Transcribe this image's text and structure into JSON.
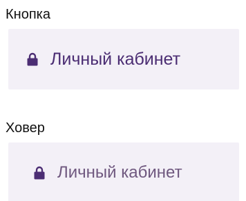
{
  "sections": {
    "normal": {
      "label": "Кнопка"
    },
    "hover": {
      "label": "Ховер"
    }
  },
  "button": {
    "label": "Личный кабинет",
    "icon": "lock-icon"
  },
  "colors": {
    "button_bg": "#f3f0f7",
    "normal_icon": "#4b2d73",
    "normal_text": "#4b2d73",
    "hover_icon": "#4b2d73",
    "hover_text": "#6f587f"
  }
}
